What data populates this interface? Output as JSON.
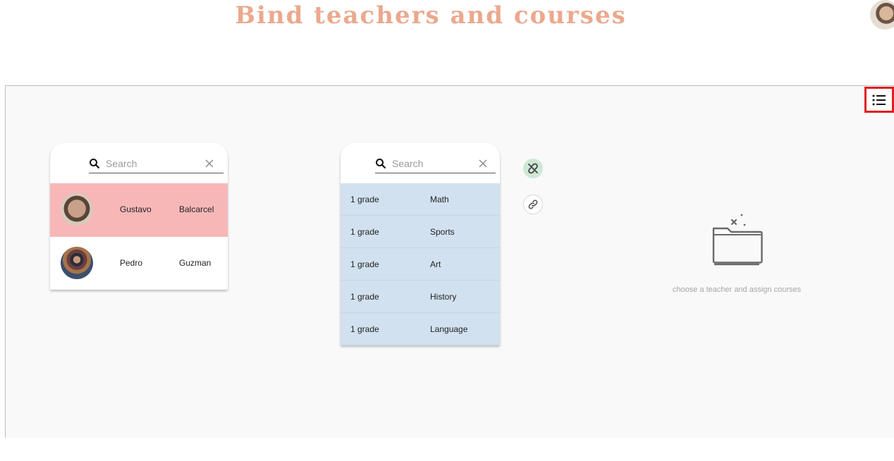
{
  "header": {
    "title": "Bind teachers and courses"
  },
  "teachers_panel": {
    "search_placeholder": "Search",
    "rows": [
      {
        "first_name": "Gustavo",
        "last_name": "Balcarcel",
        "selected": true
      },
      {
        "first_name": "Pedro",
        "last_name": "Guzman",
        "selected": false
      }
    ]
  },
  "courses_panel": {
    "search_placeholder": "Search",
    "rows": [
      {
        "grade": "1 grade",
        "course": "Math"
      },
      {
        "grade": "1 grade",
        "course": "Sports"
      },
      {
        "grade": "1 grade",
        "course": "Art"
      },
      {
        "grade": "1 grade",
        "course": "History"
      },
      {
        "grade": "1 grade",
        "course": "Language"
      }
    ]
  },
  "actions": {
    "unlink_icon": "link-off-icon",
    "link_icon": "link-icon",
    "menu_icon": "list-icon"
  },
  "empty_state": {
    "icon": "empty-folder-icon",
    "message": "choose a teacher and assign courses"
  },
  "colors": {
    "title": "#eba98e",
    "selected_teacher": "#f7b7b7",
    "course_row": "#d2e1ef",
    "unlink_button": "#cde8d6",
    "menu_highlight": "#e01e1e"
  }
}
